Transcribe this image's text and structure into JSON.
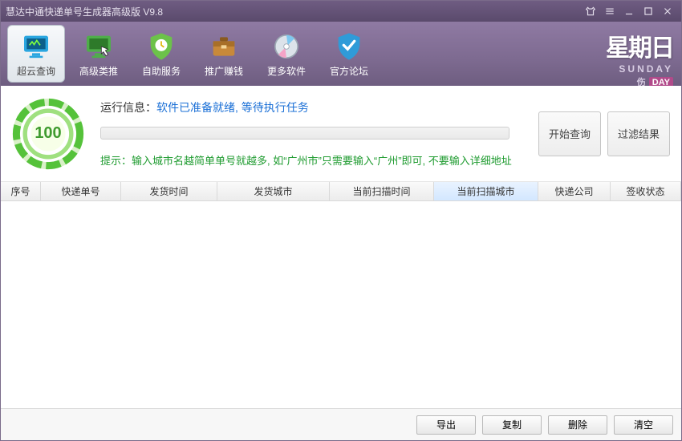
{
  "window": {
    "title": "慧达中通快递单号生成器高级版  V9.8"
  },
  "toolbar": {
    "items": [
      {
        "label": "超云查询",
        "icon": "monitor"
      },
      {
        "label": "高级类推",
        "icon": "monitor-cursor"
      },
      {
        "label": "自助服务",
        "icon": "shield-clock"
      },
      {
        "label": "推广赚钱",
        "icon": "briefcase"
      },
      {
        "label": "更多软件",
        "icon": "disc"
      },
      {
        "label": "官方论坛",
        "icon": "shield-check"
      }
    ]
  },
  "date_badge": {
    "big": "星期日",
    "en": "SUNDAY",
    "sub_pre": "伤",
    "sub": "DAY"
  },
  "gauge": {
    "value": "100"
  },
  "info": {
    "label": "运行信息：",
    "msg": "软件已准备就绪, 等待执行任务",
    "tip": "提示：输入城市名越简单单号就越多, 如“广州市”只需要输入“广州”即可, 不要输入详细地址"
  },
  "actions": {
    "query": "开始查询",
    "filter": "过滤结果"
  },
  "table": {
    "columns": [
      "序号",
      "快递单号",
      "发货时间",
      "发货城市",
      "当前扫描时间",
      "当前扫描城市",
      "快递公司",
      "签收状态"
    ],
    "sorted_index": 5
  },
  "footer": {
    "buttons": [
      "导出",
      "复制",
      "删除",
      "清空"
    ]
  }
}
